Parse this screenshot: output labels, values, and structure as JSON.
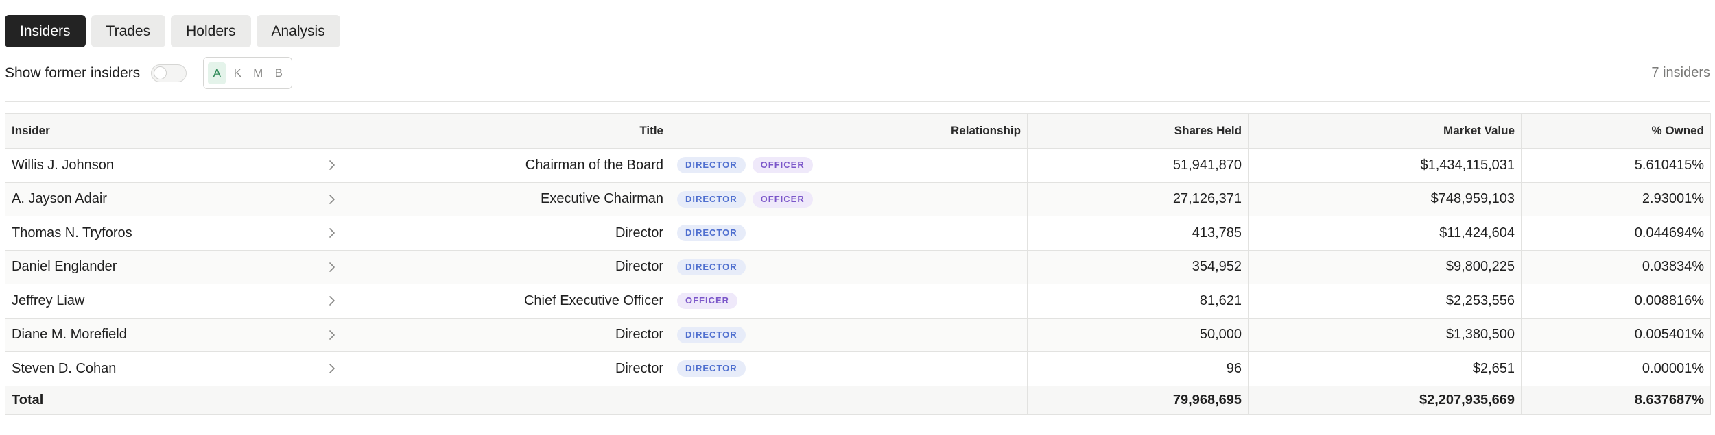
{
  "tabs": [
    {
      "label": "Insiders",
      "active": true
    },
    {
      "label": "Trades",
      "active": false
    },
    {
      "label": "Holders",
      "active": false
    },
    {
      "label": "Analysis",
      "active": false
    }
  ],
  "controls": {
    "toggle_label": "Show former insiders",
    "toggle_on": false,
    "units": [
      {
        "label": "A",
        "active": true
      },
      {
        "label": "K",
        "active": false
      },
      {
        "label": "M",
        "active": false
      },
      {
        "label": "B",
        "active": false
      }
    ],
    "count_text": "7 insiders"
  },
  "colors": {
    "active_tab_bg": "#232323",
    "director_badge_text": "#4f6fcf",
    "officer_badge_text": "#7b56c9",
    "active_unit_text": "#2f8a58"
  },
  "table": {
    "columns": [
      "Insider",
      "Title",
      "Relationship",
      "Shares Held",
      "Market Value",
      "% Owned"
    ],
    "rows": [
      {
        "name": "Willis J. Johnson",
        "title": "Chairman of the Board",
        "relationships": [
          "DIRECTOR",
          "OFFICER"
        ],
        "shares": "51,941,870",
        "value": "$1,434,115,031",
        "owned": "5.610415%"
      },
      {
        "name": "A. Jayson Adair",
        "title": "Executive Chairman",
        "relationships": [
          "DIRECTOR",
          "OFFICER"
        ],
        "shares": "27,126,371",
        "value": "$748,959,103",
        "owned": "2.93001%"
      },
      {
        "name": "Thomas N. Tryforos",
        "title": "Director",
        "relationships": [
          "DIRECTOR"
        ],
        "shares": "413,785",
        "value": "$11,424,604",
        "owned": "0.044694%"
      },
      {
        "name": "Daniel Englander",
        "title": "Director",
        "relationships": [
          "DIRECTOR"
        ],
        "shares": "354,952",
        "value": "$9,800,225",
        "owned": "0.03834%"
      },
      {
        "name": "Jeffrey Liaw",
        "title": "Chief Executive Officer",
        "relationships": [
          "OFFICER"
        ],
        "shares": "81,621",
        "value": "$2,253,556",
        "owned": "0.008816%"
      },
      {
        "name": "Diane M. Morefield",
        "title": "Director",
        "relationships": [
          "DIRECTOR"
        ],
        "shares": "50,000",
        "value": "$1,380,500",
        "owned": "0.005401%"
      },
      {
        "name": "Steven D. Cohan",
        "title": "Director",
        "relationships": [
          "DIRECTOR"
        ],
        "shares": "96",
        "value": "$2,651",
        "owned": "0.00001%"
      }
    ],
    "total": {
      "label": "Total",
      "shares": "79,968,695",
      "value": "$2,207,935,669",
      "owned": "8.637687%"
    }
  }
}
